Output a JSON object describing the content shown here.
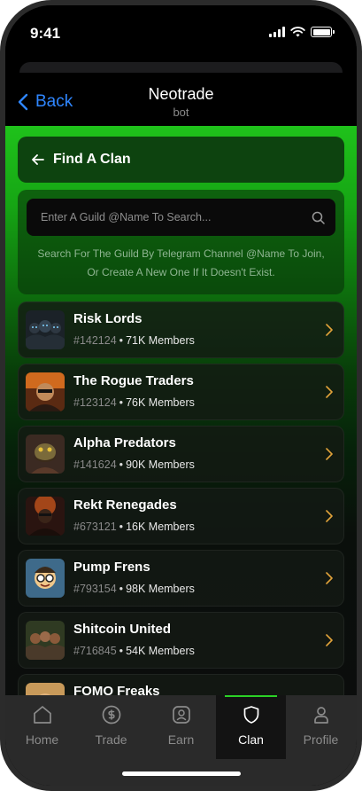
{
  "status_bar": {
    "time": "9:41"
  },
  "header": {
    "back_label": "Back",
    "title": "Neotrade",
    "subtitle": "bot"
  },
  "find_card": {
    "title": "Find A Clan"
  },
  "search": {
    "placeholder": "Enter A Guild @Name To Search...",
    "help_line1": "Search For The Guild By Telegram Channel @Name To Join,",
    "help_line2": "Or Create A New One If It Doesn't Exist."
  },
  "clans": [
    {
      "name": "Risk Lords",
      "id": "#142124",
      "members": "71K Members",
      "avatar": "risk-lords-avatar"
    },
    {
      "name": "The Rogue Traders",
      "id": "#123124",
      "members": "76K Members",
      "avatar": "rogue-traders-avatar"
    },
    {
      "name": "Alpha Predators",
      "id": "#141624",
      "members": "90K Members",
      "avatar": "alpha-predators-avatar"
    },
    {
      "name": "Rekt Renegades",
      "id": "#673121",
      "members": "16K Members",
      "avatar": "rekt-renegades-avatar"
    },
    {
      "name": "Pump Frens",
      "id": "#793154",
      "members": "98K Members",
      "avatar": "pump-frens-avatar"
    },
    {
      "name": "Shitcoin United",
      "id": "#716845",
      "members": "54K Members",
      "avatar": "shitcoin-united-avatar"
    },
    {
      "name": "FOMO Freaks",
      "id": "",
      "members": "",
      "avatar": "fomo-freaks-avatar"
    }
  ],
  "separator": "•",
  "tabs": [
    {
      "label": "Home",
      "icon": "home-icon"
    },
    {
      "label": "Trade",
      "icon": "trade-icon"
    },
    {
      "label": "Earn",
      "icon": "earn-icon"
    },
    {
      "label": "Clan",
      "icon": "shield-icon",
      "active": true
    },
    {
      "label": "Profile",
      "icon": "profile-icon"
    }
  ],
  "colors": {
    "accent_green": "#2bd126",
    "link_blue": "#2f86ff",
    "background": "#000000"
  }
}
